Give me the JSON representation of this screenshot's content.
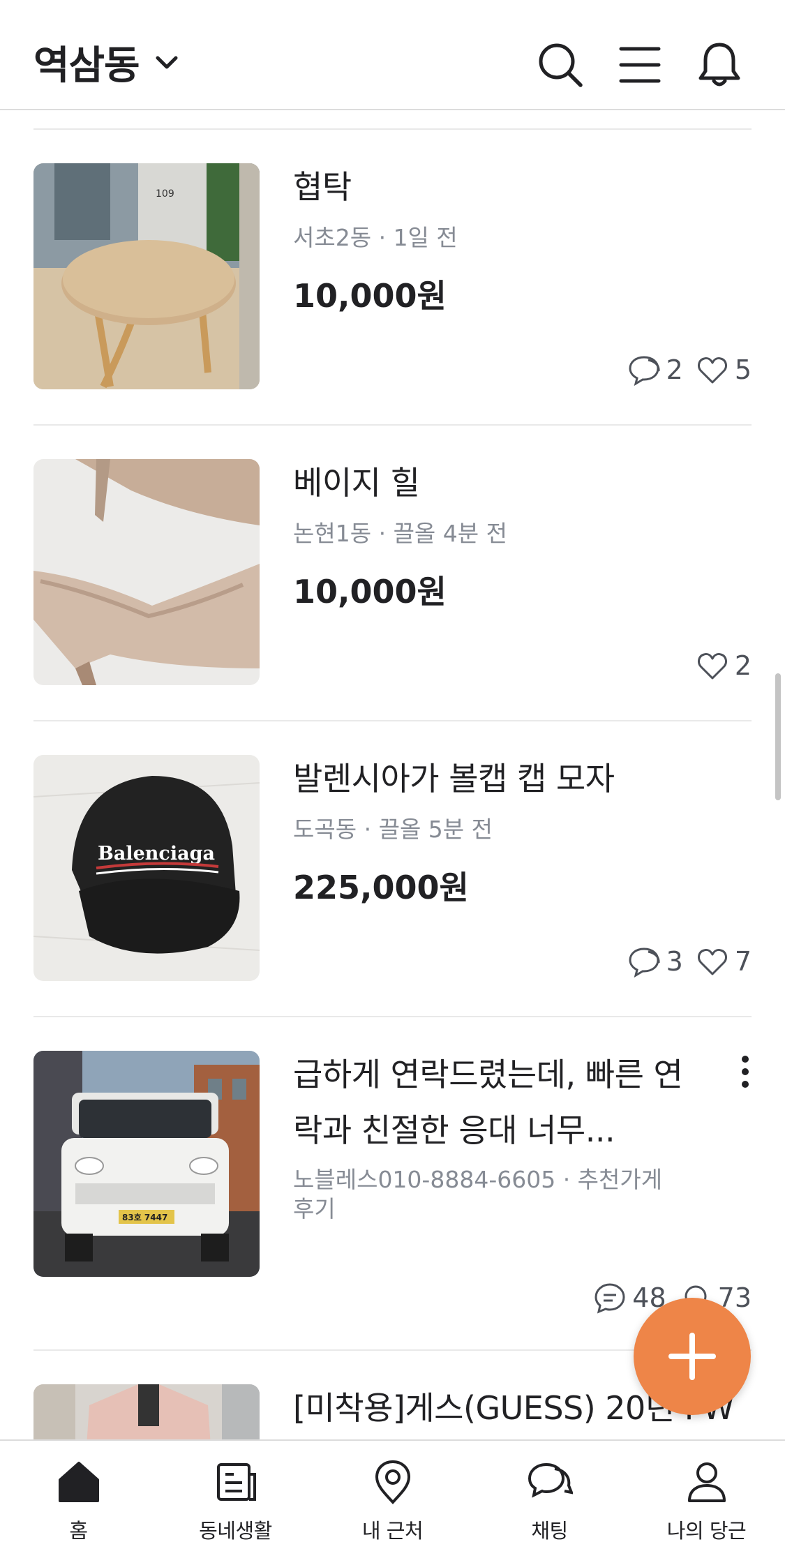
{
  "header": {
    "location": "역삼동",
    "icons": [
      "search-icon",
      "menu-icon",
      "bell-icon"
    ]
  },
  "colors": {
    "accent": "#ee8548",
    "text": "#212124",
    "meta": "#868b94",
    "divider": "#e9e9e9"
  },
  "listings": [
    {
      "title": "협탁",
      "location": "서초2동",
      "time": "1일 전",
      "price": "10,000원",
      "comments": "2",
      "likes": "5",
      "image": "round-wooden-side-table"
    },
    {
      "title": "베이지 힐",
      "location": "논현1동",
      "time": "끌올 4분 전",
      "price": "10,000원",
      "likes": "2",
      "image": "beige-heels"
    },
    {
      "title": "발렌시아가 볼캡 캡 모자",
      "location": "도곡동",
      "time": "끌올 5분 전",
      "price": "225,000원",
      "comments": "3",
      "likes": "7",
      "image": "black-balenciaga-cap",
      "image_text": "Balenciaga"
    },
    {
      "title_line1": "급하게 연락드렸는데, 빠른 연",
      "title_line2": "락과 친절한 응대 너무...",
      "meta_line1": "노블레스010-8884-6605 · 추천가게",
      "meta_line2": "후기",
      "comments": "48",
      "likes": "73",
      "image": "white-truck",
      "plate": "83호 7447"
    },
    {
      "title": "[미착용]게스(GUESS) 20년 FW",
      "image": "pink-fleece-jacket"
    }
  ],
  "nav": {
    "items": [
      {
        "label": "홈",
        "icon": "home-icon",
        "active": true
      },
      {
        "label": "동네생활",
        "icon": "neighborhood-icon"
      },
      {
        "label": "내 근처",
        "icon": "location-pin-icon"
      },
      {
        "label": "채팅",
        "icon": "chat-icon"
      },
      {
        "label": "나의 당근",
        "icon": "profile-icon"
      }
    ]
  },
  "fab": {
    "icon": "plus-icon"
  }
}
